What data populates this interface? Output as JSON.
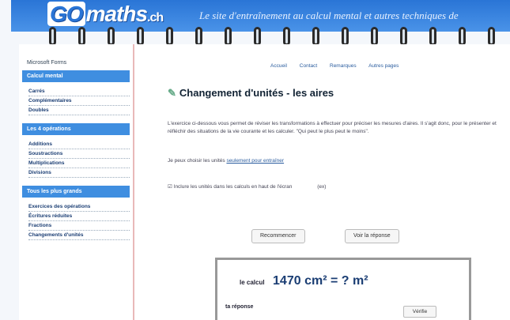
{
  "header": {
    "logo_go": "GO",
    "logo_rest": "maths",
    "logo_ext": ".ch",
    "tagline": "Le site d'entraînement au calcul mental et autres techniques de"
  },
  "sidebar": {
    "location": "Microsoft Forms",
    "sections": [
      {
        "title": "Calcul mental",
        "items": [
          "Carrés",
          "Complémentaires",
          "Doubles"
        ]
      },
      {
        "title": "Les 4 opérations",
        "items": [
          "Additions",
          "Soustractions",
          "Multiplications",
          "Divisions"
        ]
      },
      {
        "title": "Tous les plus grands",
        "items": [
          "Exercices des opérations",
          "Écritures réduites",
          "Fractions",
          "Changements d'unités"
        ]
      }
    ]
  },
  "topnav": [
    "Accueil",
    "Contact",
    "Remarques",
    "Autres pages"
  ],
  "page": {
    "title": "Changement d'unités - les aires",
    "intro": "L'exercice ci-dessous vous permet de réviser les transformations à effectuer pour préciser les mesures d'aires. Il s'agit donc, pour le présenter et réfléchir des situations de la vie courante et les calculer. \"Qui peut le plus peut le moins\".",
    "option1_text": "Je peux choisir les unités",
    "option1_link": "seulement pour entraîner",
    "option2_text": "Inclure les unités dans les calculs en haut de l'écran",
    "option2_suffix": "(ex)"
  },
  "buttons": {
    "restart": "Recommencer",
    "show_answer": "Voir la réponse"
  },
  "calc": {
    "label": "le calcul",
    "expression": "1470 cm² = ? m²",
    "answer_label": "ta réponse",
    "verify": "Vérifie"
  }
}
